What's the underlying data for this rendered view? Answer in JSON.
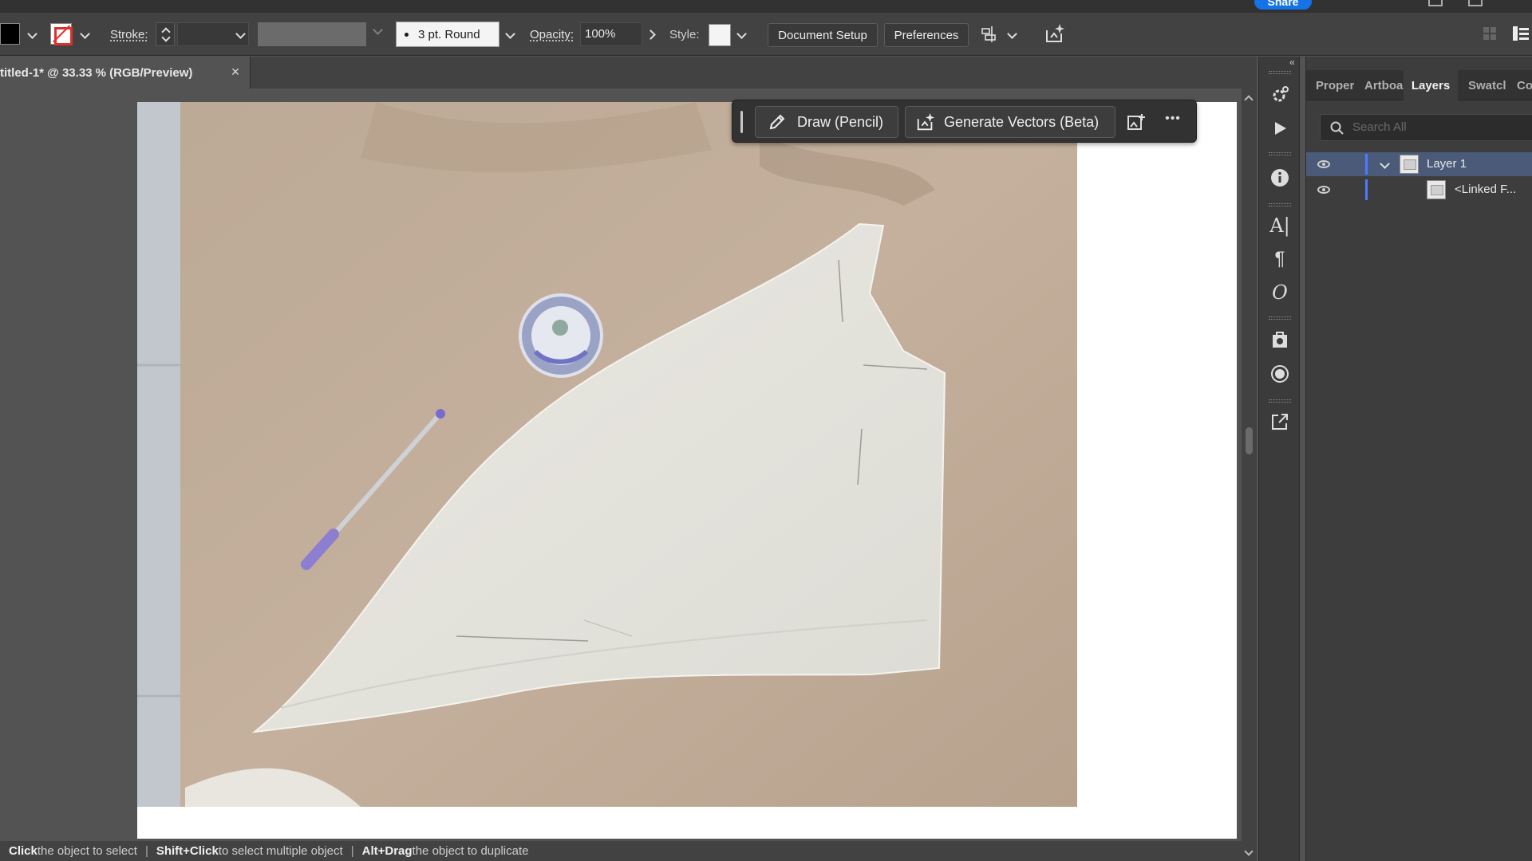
{
  "controlbar": {
    "stroke_label": "Stroke:",
    "brush_label": "3 pt. Round",
    "opacity_label": "Opacity:",
    "opacity_value": "100%",
    "style_label": "Style:",
    "document_setup": "Document Setup",
    "preferences": "Preferences",
    "colors": {
      "fill": "#000000",
      "stroke_none": "#e0302b"
    }
  },
  "topbar": {
    "share": "Share"
  },
  "document": {
    "tab_title": "titled-1* @ 33.33 % (RGB/Preview)",
    "close_glyph": "×"
  },
  "taskbar": {
    "draw_pencil": "Draw (Pencil)",
    "generate_vectors": "Generate Vectors (Beta)",
    "more": "•••"
  },
  "panel": {
    "tabs": [
      "Proper",
      "Artboa",
      "Layers",
      "Swatcl",
      "Co"
    ],
    "active_tab": "Layers",
    "search_placeholder": "Search All",
    "layers": [
      {
        "name": "Layer 1",
        "selected": true,
        "expanded": true
      },
      {
        "name": "<Linked F...",
        "selected": false
      }
    ],
    "accent": "#4f7cff"
  },
  "status": {
    "hint1_key": "Click",
    "hint1_text": " the object to select",
    "hint2_key": "Shift+Click",
    "hint2_text": " to select multiple object",
    "hint3_key": "Alt+Drag",
    "hint3_text": " the object to duplicate",
    "separator": "|"
  },
  "icons": {
    "strip": [
      "asset-export-icon",
      "actions-play-icon",
      "info-icon",
      "character-icon",
      "paragraph-icon",
      "opentype-icon",
      "image-trace-icon",
      "appearance-icon",
      "export-icon"
    ]
  }
}
